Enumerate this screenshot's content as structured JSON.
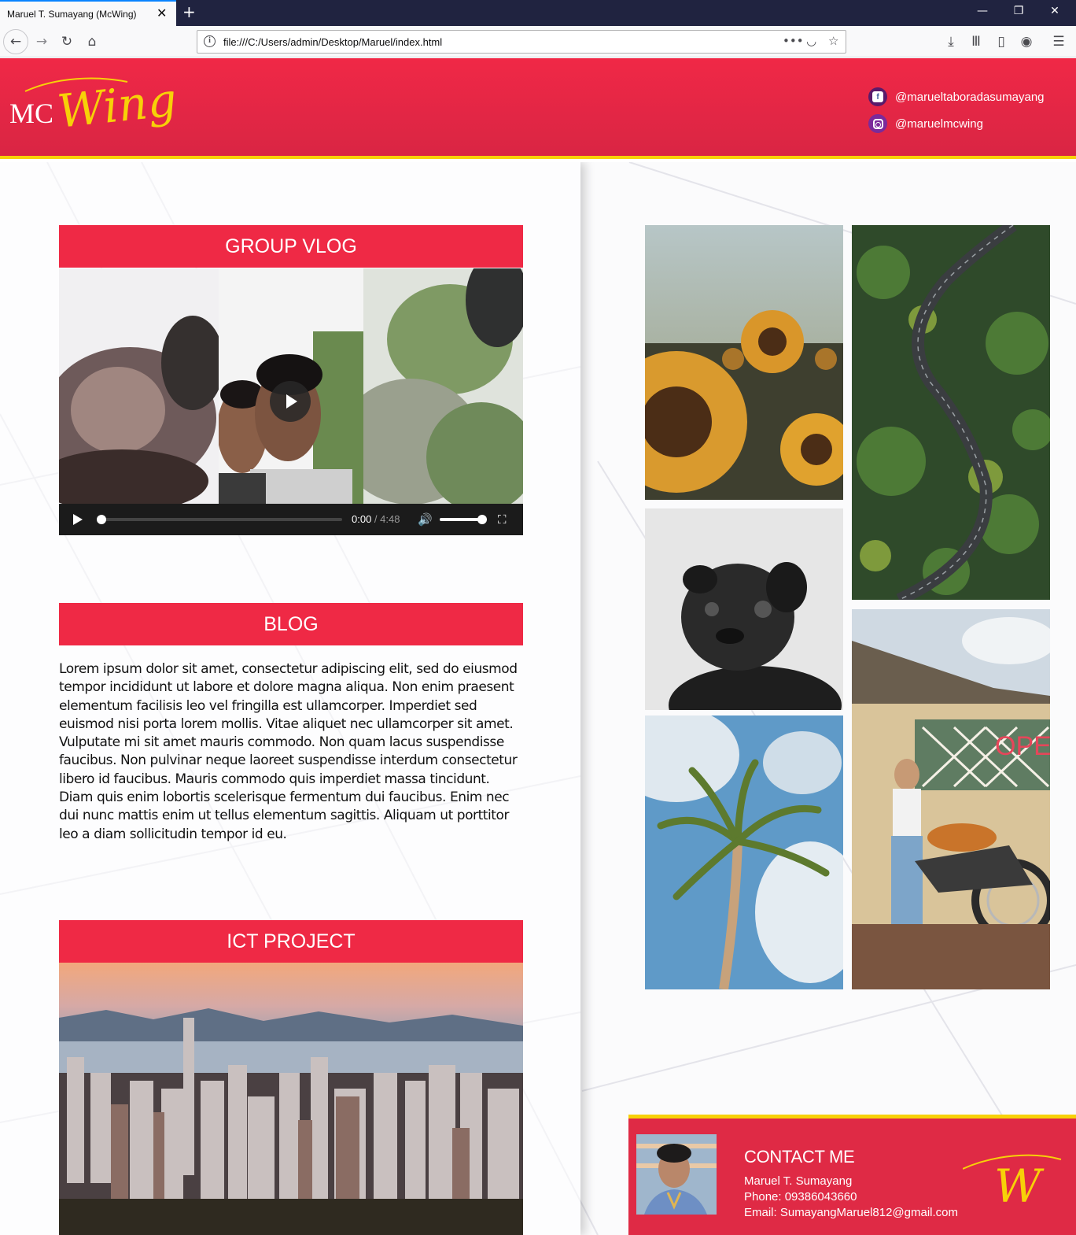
{
  "browser": {
    "tab_title": "Maruel T. Sumayang (McWing)",
    "url": "file:///C:/Users/admin/Desktop/Maruel/index.html"
  },
  "header": {
    "logo_mc": "MC",
    "logo_wing": "Wing",
    "facebook_handle": "@marueltaboradasumayang",
    "instagram_handle": "@maruelmcwing"
  },
  "sections": {
    "vlog_title": "GROUP VLOG",
    "blog_title": "BLOG",
    "ict_title": "ICT PROJECT"
  },
  "video": {
    "current_time": "0:00",
    "separator": " / ",
    "duration": "4:48",
    "progress": 0,
    "volume": 1
  },
  "blog": {
    "text": "Lorem ipsum dolor sit amet, consectetur adipiscing elit, sed do eiusmod tempor incididunt ut labore et dolore magna aliqua. Non enim praesent elementum facilisis leo vel fringilla est ullamcorper. Imperdiet sed euismod nisi porta lorem mollis. Vitae aliquet nec ullamcorper sit amet. Vulputate mi sit amet mauris commodo. Non quam lacus suspendisse faucibus. Non pulvinar neque laoreet suspendisse interdum consectetur libero id faucibus. Mauris commodo quis imperdiet massa tincidunt. Diam quis enim lobortis scelerisque fermentum dui faucibus. Enim nec dui nunc mattis enim ut tellus elementum sagittis. Aliquam ut porttitor leo a diam sollicitudin tempor id eu."
  },
  "gallery_sign_text": "OPE",
  "contact": {
    "title": "CONTACT ME",
    "name": "Maruel T. Sumayang",
    "phone": "Phone: 09386043660",
    "email": "Email: SumayangMaruel812@gmail.com",
    "logo_letter": "W"
  },
  "colors": {
    "brand_red": "#ef2945",
    "accent_yellow": "#f7d108"
  }
}
